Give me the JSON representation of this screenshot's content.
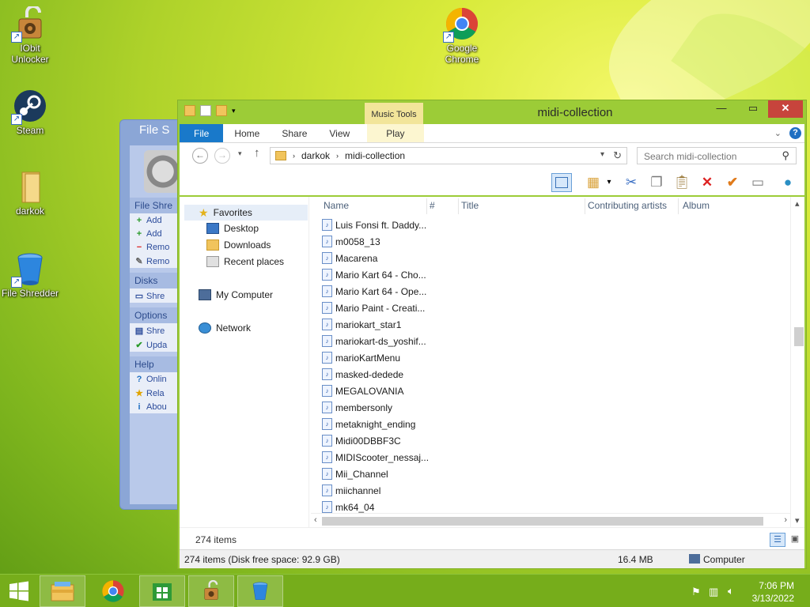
{
  "desktop": {
    "icons": [
      {
        "label": "IObit Unlocker",
        "icon": "padlock-gear-icon"
      },
      {
        "label": "Steam",
        "icon": "steam-icon"
      },
      {
        "label": "darkok",
        "icon": "folder-icon"
      },
      {
        "label": "File Shredder",
        "icon": "recycle-bin-icon"
      },
      {
        "label": "Google Chrome",
        "icon": "chrome-icon"
      }
    ]
  },
  "shredder": {
    "title": "File S",
    "groups": [
      {
        "header": "File Shre",
        "items": [
          {
            "label": "Add",
            "icon": "+"
          },
          {
            "label": "Add",
            "icon": "+"
          },
          {
            "label": "Remo",
            "icon": "−"
          },
          {
            "label": "Remo",
            "icon": "✎"
          }
        ]
      },
      {
        "header": "Disks",
        "items": [
          {
            "label": "Shre",
            "icon": "▭"
          }
        ]
      },
      {
        "header": "Options",
        "items": [
          {
            "label": "Shre",
            "icon": "▤"
          },
          {
            "label": "Upda",
            "icon": "✔"
          }
        ]
      },
      {
        "header": "Help",
        "items": [
          {
            "label": "Onlin",
            "icon": "?"
          },
          {
            "label": "Rela",
            "icon": "★"
          },
          {
            "label": "Abou",
            "icon": "i"
          }
        ]
      }
    ]
  },
  "explorer": {
    "title": "midi-collection",
    "context_tab": "Music Tools",
    "tabs": {
      "file": "File",
      "home": "Home",
      "share": "Share",
      "view": "View",
      "play": "Play"
    },
    "address": {
      "root": "darkok",
      "current": "midi-collection"
    },
    "search_placeholder": "Search midi-collection",
    "nav": {
      "favorites": "Favorites",
      "desktop": "Desktop",
      "downloads": "Downloads",
      "recent": "Recent places",
      "computer": "My Computer",
      "network": "Network"
    },
    "columns": {
      "name": "Name",
      "number": "#",
      "title": "Title",
      "artists": "Contributing artists",
      "album": "Album"
    },
    "files": [
      "Luis Fonsi ft. Daddy...",
      "m0058_13",
      "Macarena",
      "Mario Kart 64 - Cho...",
      "Mario Kart 64 - Ope...",
      "Mario Paint - Creati...",
      "mariokart_star1",
      "mariokart-ds_yoshif...",
      "marioKartMenu",
      "masked-dedede",
      "MEGALOVANIA",
      "membersonly",
      "metaknight_ending",
      "Midi00DBBF3C",
      "MIDIScooter_nessaj...",
      "Mii_Channel",
      "miichannel",
      "mk64_04"
    ],
    "item_count": "274 items",
    "status": {
      "items_free": "274 items (Disk free space: 92.9 GB)",
      "size": "16.4 MB",
      "location": "Computer"
    },
    "scroll_position": 0.41
  },
  "taskbar": {
    "time": "7:06 PM",
    "date": "3/13/2022",
    "apps": [
      "windows-start-icon",
      "file-explorer-icon",
      "chrome-icon",
      "store-icon",
      "iobit-unlocker-icon",
      "file-shredder-icon"
    ]
  },
  "colors": {
    "accent": "#1979ca",
    "window_frame": "#9ccc37",
    "taskbar": "#76ad1b",
    "close": "#c7443c"
  }
}
